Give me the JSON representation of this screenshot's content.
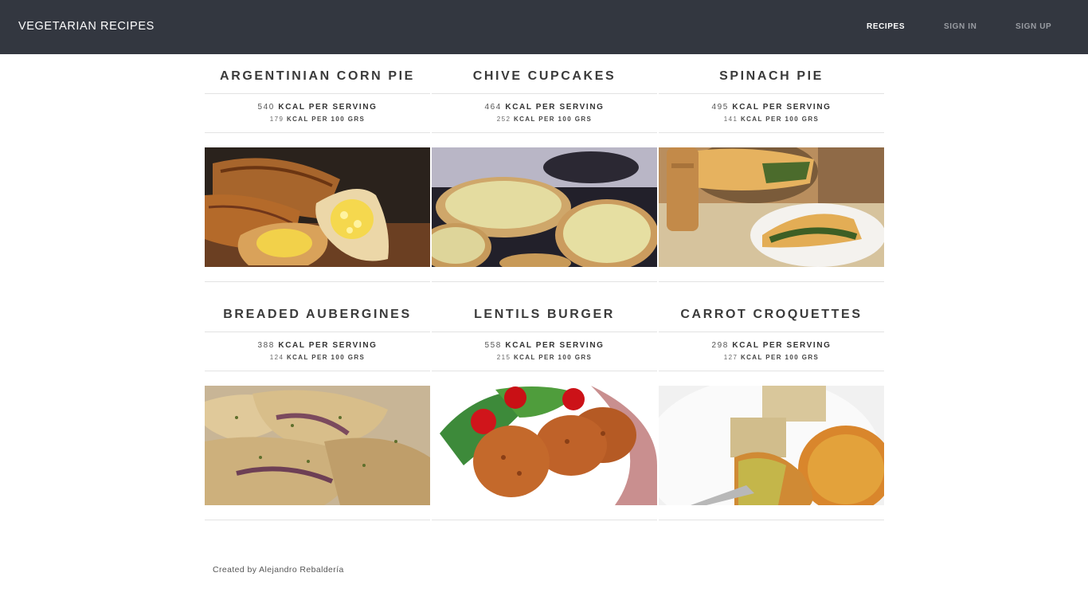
{
  "nav": {
    "brand": "VEGETARIAN RECIPES",
    "links": [
      {
        "label": "RECIPES",
        "active": true
      },
      {
        "label": "SIGN IN",
        "active": false
      },
      {
        "label": "SIGN UP",
        "active": false
      }
    ]
  },
  "recipes": [
    {
      "title": "ARGENTINIAN CORN PIE",
      "kcal_serving": "540",
      "kcal_100g": "179"
    },
    {
      "title": "CHIVE CUPCAKES",
      "kcal_serving": "464",
      "kcal_100g": "252"
    },
    {
      "title": "SPINACH PIE",
      "kcal_serving": "495",
      "kcal_100g": "141"
    },
    {
      "title": "BREADED AUBERGINES",
      "kcal_serving": "388",
      "kcal_100g": "124"
    },
    {
      "title": "LENTILS BURGER",
      "kcal_serving": "558",
      "kcal_100g": "215"
    },
    {
      "title": "CARROT CROQUETTES",
      "kcal_serving": "298",
      "kcal_100g": "127"
    }
  ],
  "labels": {
    "per_serving": "KCAL PER SERVING",
    "per_100": "KCAL PER 100 GRS"
  },
  "footer": {
    "credit": "Created by Alejandro Rebaldería"
  },
  "colors": {
    "navbar": "#333740",
    "active_link": "#ffffff",
    "inactive_link": "#9a9da3"
  }
}
